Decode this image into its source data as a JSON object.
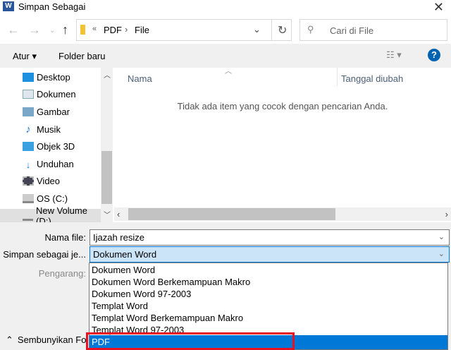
{
  "window": {
    "title": "Simpan Sebagai",
    "app_icon": "W"
  },
  "address": {
    "sep": "«",
    "crumbs": [
      "PDF",
      "File"
    ],
    "search_placeholder": "Cari di File"
  },
  "toolbar": {
    "organize": "Atur ▾",
    "new_folder": "Folder baru",
    "help": "?"
  },
  "nav": {
    "items": [
      "Desktop",
      "Dokumen",
      "Gambar",
      "Musik",
      "Objek 3D",
      "Unduhan",
      "Video",
      "OS (C:)",
      "New Volume (D:)"
    ]
  },
  "columns": {
    "name": "Nama",
    "date": "Tanggal diubah"
  },
  "empty_message": "Tidak ada item yang cocok dengan pencarian Anda.",
  "form": {
    "filename_label": "Nama file:",
    "filename_value": "Ijazah resize",
    "type_label": "Simpan sebagai je...",
    "type_value": "Dokumen Word",
    "author_label": "Pengarang:"
  },
  "type_options": [
    "Dokumen Word",
    "Dokumen Word Berkemampuan Makro",
    "Dokumen Word 97-2003",
    "Templat Word",
    "Templat Word Berkemampuan Makro",
    "Templat Word 97-2003",
    "PDF"
  ],
  "hide_folders": "Sembunyikan Folder",
  "colors": {
    "accent": "#0078d7",
    "highlight_box": "#e81123",
    "select_bg": "#cce4f7"
  }
}
